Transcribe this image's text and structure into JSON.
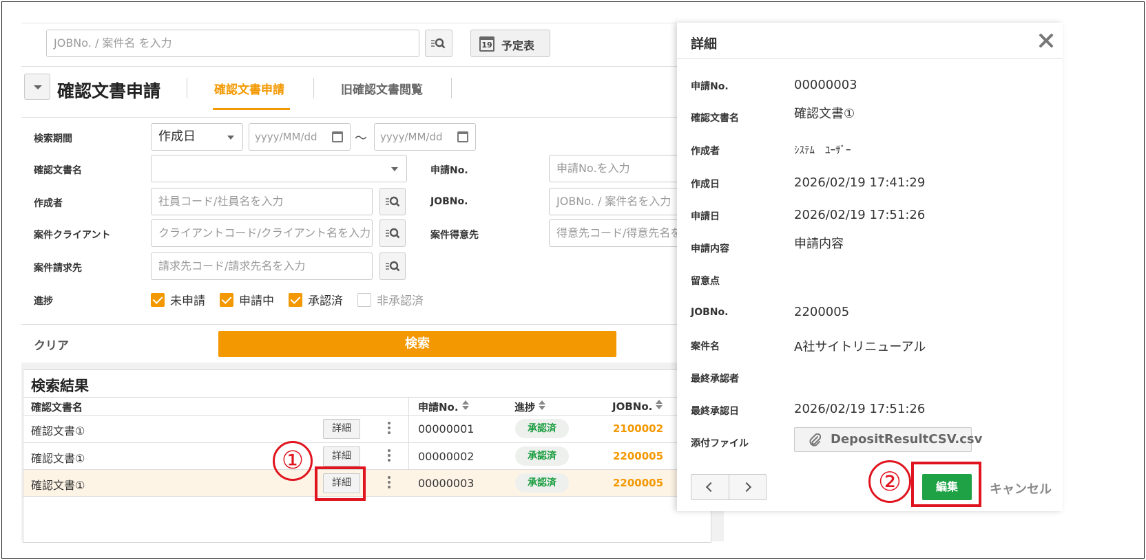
{
  "topbar": {
    "job_search_placeholder": "JOBNo. / 案件名 を入力",
    "calendar_icon_number": "19",
    "calendar_label": "予定表"
  },
  "header": {
    "title": "確認文書申請",
    "tabs": [
      {
        "label": "確認文書申請",
        "active": true
      },
      {
        "label": "旧確認文書閲覧",
        "active": false
      }
    ]
  },
  "form": {
    "period_label": "検索期間",
    "period_type": "作成日",
    "date_from_placeholder": "yyyy/MM/dd",
    "date_to_placeholder": "yyyy/MM/dd",
    "tilde": "～",
    "docname_label": "確認文書名",
    "appno_label": "申請No.",
    "appno_placeholder": "申請No.を入力",
    "author_label": "作成者",
    "author_placeholder": "社員コード/社員名を入力",
    "jobno_label": "JOBNo.",
    "jobno_placeholder": "JOBNo. / 案件名を入力",
    "client_label": "案件クライアント",
    "client_placeholder": "クライアントコード/クライアント名を入力",
    "customer_label": "案件得意先",
    "customer_placeholder": "得意先コード/得意先名を入力",
    "billing_label": "案件請求先",
    "billing_placeholder": "請求先コード/請求先名を入力",
    "progress_label": "進捗",
    "progress_options": [
      {
        "label": "未申請",
        "checked": true
      },
      {
        "label": "申請中",
        "checked": true
      },
      {
        "label": "承認済",
        "checked": true
      },
      {
        "label": "非承認済",
        "checked": false
      }
    ],
    "clear_label": "クリア",
    "search_label": "検索"
  },
  "results": {
    "title": "検索結果",
    "columns": [
      "確認文書名",
      "申請No.",
      "進捗",
      "JOBNo."
    ],
    "detail_label": "詳細",
    "rows": [
      {
        "name": "確認文書①",
        "app_no": "00000001",
        "status": "承認済",
        "job_no": "2100002",
        "selected": false
      },
      {
        "name": "確認文書①",
        "app_no": "00000002",
        "status": "承認済",
        "job_no": "2200005",
        "selected": false
      },
      {
        "name": "確認文書①",
        "app_no": "00000003",
        "status": "承認済",
        "job_no": "2200005",
        "selected": true
      }
    ]
  },
  "annotations": {
    "marker_1": "①",
    "marker_2": "②",
    "color": "#e0141e"
  },
  "drawer": {
    "title": "詳細",
    "fields": [
      {
        "label": "申請No.",
        "value": "00000003"
      },
      {
        "label": "確認文書名",
        "value": "確認文書①"
      },
      {
        "label": "作成者",
        "value": "ｼｽﾃﾑ　ﾕｰｻﾞｰ"
      },
      {
        "label": "作成日",
        "value": "2026/02/19 17:41:29"
      },
      {
        "label": "申請日",
        "value": "2026/02/19 17:51:26"
      },
      {
        "label": "申請内容",
        "value": "申請内容"
      },
      {
        "label": "留意点",
        "value": ""
      },
      {
        "label": "JOBNo.",
        "value": "2200005"
      },
      {
        "label": "案件名",
        "value": "A社サイトリニューアル"
      },
      {
        "label": "最終承認者",
        "value": ""
      },
      {
        "label": "最終承認日",
        "value": "2026/02/19 17:51:26"
      }
    ],
    "attachment_label": "添付ファイル",
    "attachment_file": "DepositResultCSV.csv",
    "edit_label": "編集",
    "cancel_label": "キャンセル"
  },
  "colors": {
    "accent": "#f39800",
    "approved": "#1a9d3f",
    "edit_button": "#1fa246",
    "annotation": "#e0141e"
  }
}
